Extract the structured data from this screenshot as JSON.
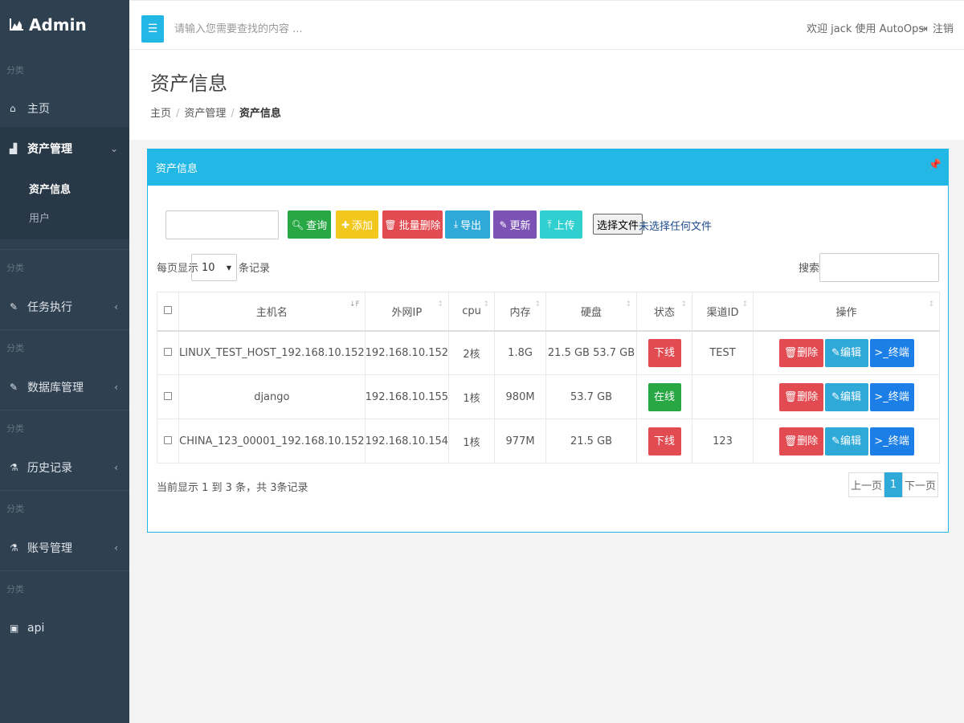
{
  "brand": {
    "title": "Admin"
  },
  "sidebar": {
    "section_label": "分类",
    "items": [
      {
        "label": "主页",
        "icon": "home-icon"
      },
      {
        "label": "资产管理",
        "icon": "chart-icon"
      },
      {
        "label": "任务执行",
        "icon": "edit-icon"
      },
      {
        "label": "数据库管理",
        "icon": "edit-icon"
      },
      {
        "label": "历史记录",
        "icon": "flask-icon"
      },
      {
        "label": "账号管理",
        "icon": "flask-icon"
      },
      {
        "label": "api",
        "icon": "image-icon"
      }
    ],
    "subitems": [
      {
        "label": "资产信息"
      },
      {
        "label": "用户"
      }
    ]
  },
  "topbar": {
    "search_placeholder": "请输入您需要查找的内容 ...",
    "welcome": "欢迎 jack 使用 AutoOps",
    "logout": "注销"
  },
  "page": {
    "title": "资产信息",
    "breadcrumb": [
      "主页",
      "资产管理",
      "资产信息"
    ]
  },
  "panel": {
    "title": "资产信息",
    "buttons": {
      "query": "查询",
      "add": "添加",
      "batch_delete": "批量删除",
      "export": "导出",
      "update": "更新",
      "upload": "上传"
    },
    "file_choose": "选择文件",
    "file_none": "未选择任何文件",
    "length_prefix": "每页显示",
    "length_value": "10",
    "length_suffix": "条记录",
    "search_label": "搜索"
  },
  "table": {
    "headers": [
      "主机名",
      "外网IP",
      "cpu",
      "内存",
      "硬盘",
      "状态",
      "渠道ID",
      "操作"
    ],
    "rows": [
      {
        "hostname": "LINUX_TEST_HOST_192.168.10.152",
        "ip": "192.168.10.152",
        "cpu": "2核",
        "mem": "1.8G",
        "disk": "21.5 GB 53.7 GB",
        "status": "下线",
        "channel": "TEST"
      },
      {
        "hostname": "django",
        "ip": "192.168.10.155",
        "cpu": "1核",
        "mem": "980M",
        "disk": "53.7 GB",
        "status": "在线",
        "channel": ""
      },
      {
        "hostname": "CHINA_123_00001_192.168.10.152",
        "ip": "192.168.10.154",
        "cpu": "1核",
        "mem": "977M",
        "disk": "21.5 GB",
        "status": "下线",
        "channel": "123"
      }
    ],
    "actions": {
      "delete": "删除",
      "edit": "编辑",
      "terminal": "终端"
    }
  },
  "footer": {
    "info": "当前显示 1 到 3 条，共 3条记录",
    "prev": "上一页",
    "current": "1",
    "next": "下一页"
  },
  "colors": {
    "sidebar_bg": "#2f4050",
    "accent": "#23b7e5",
    "green": "#27a844",
    "red": "#e24b52"
  }
}
